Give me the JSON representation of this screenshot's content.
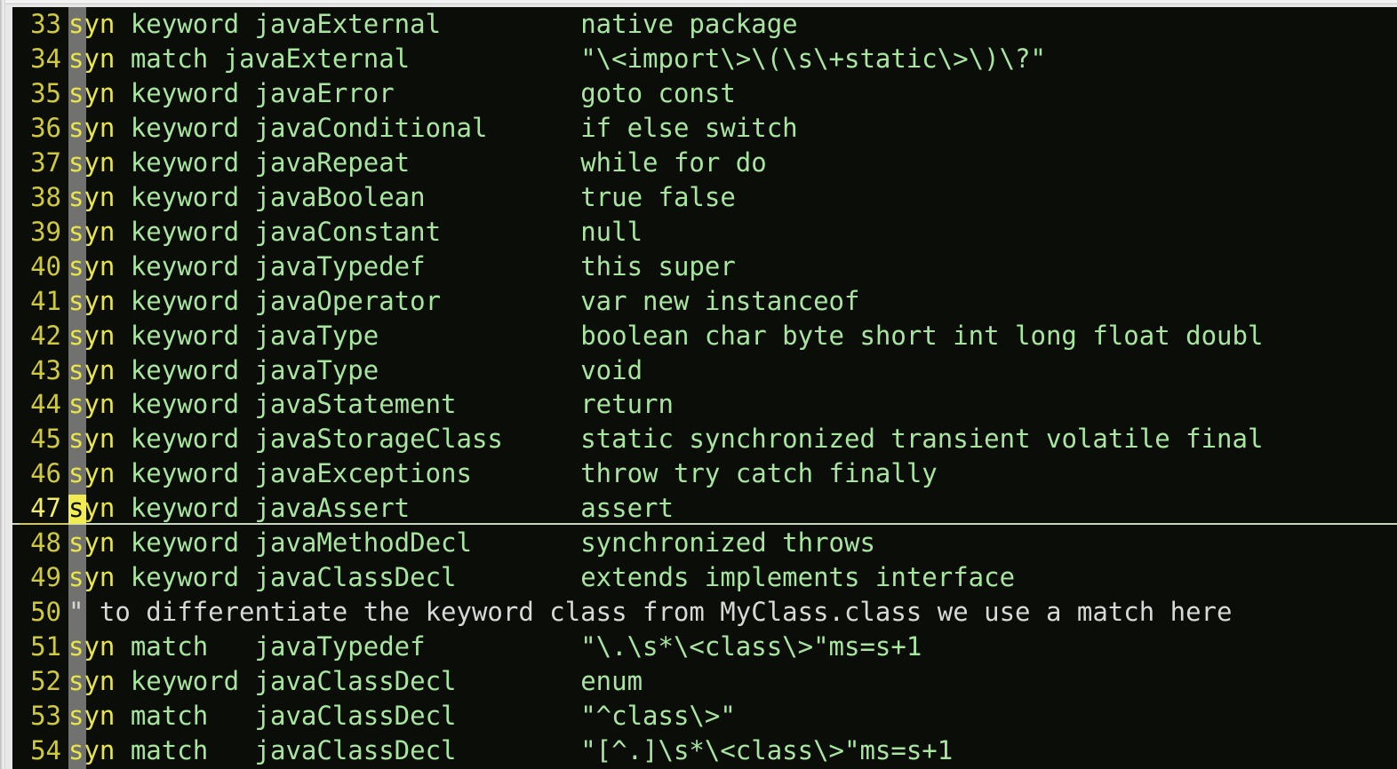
{
  "window": {
    "app": "vim-terminal",
    "background_color": "#0b0d08",
    "frame_color": "#e8e8e8"
  },
  "editor": {
    "mode": "normal",
    "cursor_line_number": "47",
    "cursor_column_index": 0,
    "cursor_char": "s",
    "colors": {
      "background": "#0b0d08",
      "line_number": "#cfc93f",
      "cursor_line_number": "#f2ee6a",
      "keyword": "#e8e54a",
      "text": "#a8e6a0",
      "comment": "#d8d8d8",
      "cursor_column": "#8e8e8e",
      "cursor_block": "#f0ec52",
      "cursor_line_underline": "#c7d8bf"
    },
    "lines": [
      {
        "num": "33",
        "kw": "syn",
        "rest": " keyword javaExternal",
        "col2": "native package",
        "type": "code"
      },
      {
        "num": "34",
        "kw": "syn",
        "rest": " match javaExternal",
        "col2": "\"\\<import\\>\\(\\s\\+static\\>\\)\\?\"",
        "type": "code"
      },
      {
        "num": "35",
        "kw": "syn",
        "rest": " keyword javaError",
        "col2": "goto const",
        "type": "code"
      },
      {
        "num": "36",
        "kw": "syn",
        "rest": " keyword javaConditional",
        "col2": "if else switch",
        "type": "code"
      },
      {
        "num": "37",
        "kw": "syn",
        "rest": " keyword javaRepeat",
        "col2": "while for do",
        "type": "code"
      },
      {
        "num": "38",
        "kw": "syn",
        "rest": " keyword javaBoolean",
        "col2": "true false",
        "type": "code"
      },
      {
        "num": "39",
        "kw": "syn",
        "rest": " keyword javaConstant",
        "col2": "null",
        "type": "code"
      },
      {
        "num": "40",
        "kw": "syn",
        "rest": " keyword javaTypedef",
        "col2": "this super",
        "type": "code"
      },
      {
        "num": "41",
        "kw": "syn",
        "rest": " keyword javaOperator",
        "col2": "var new instanceof",
        "type": "code"
      },
      {
        "num": "42",
        "kw": "syn",
        "rest": " keyword javaType",
        "col2": "boolean char byte short int long float doubl",
        "type": "code"
      },
      {
        "num": "43",
        "kw": "syn",
        "rest": " keyword javaType",
        "col2": "void",
        "type": "code"
      },
      {
        "num": "44",
        "kw": "syn",
        "rest": " keyword javaStatement",
        "col2": "return",
        "type": "code"
      },
      {
        "num": "45",
        "kw": "syn",
        "rest": " keyword javaStorageClass",
        "col2": "static synchronized transient volatile final",
        "type": "code"
      },
      {
        "num": "46",
        "kw": "syn",
        "rest": " keyword javaExceptions",
        "col2": "throw try catch finally",
        "type": "code"
      },
      {
        "num": "47",
        "kw": "syn",
        "rest": " keyword javaAssert",
        "col2": "assert",
        "type": "code",
        "cursorline": true
      },
      {
        "num": "48",
        "kw": "syn",
        "rest": " keyword javaMethodDecl",
        "col2": "synchronized throws",
        "type": "code"
      },
      {
        "num": "49",
        "kw": "syn",
        "rest": " keyword javaClassDecl",
        "col2": "extends implements interface",
        "type": "code"
      },
      {
        "num": "50",
        "kw": "",
        "rest": "\" to differentiate the keyword class from MyClass.class we use a match here",
        "col2": "",
        "type": "comment"
      },
      {
        "num": "51",
        "kw": "syn",
        "rest": " match   javaTypedef",
        "col2": "\"\\.\\s*\\<class\\>\"ms=s+1",
        "type": "code"
      },
      {
        "num": "52",
        "kw": "syn",
        "rest": " keyword javaClassDecl",
        "col2": "enum",
        "type": "code"
      },
      {
        "num": "53",
        "kw": "syn",
        "rest": " match   javaClassDecl",
        "col2": "\"^class\\>\"",
        "type": "code"
      },
      {
        "num": "54",
        "kw": "syn",
        "rest": " match   javaClassDecl",
        "col2": "\"[^.]\\s*\\<class\\>\"ms=s+1",
        "type": "code"
      }
    ]
  }
}
